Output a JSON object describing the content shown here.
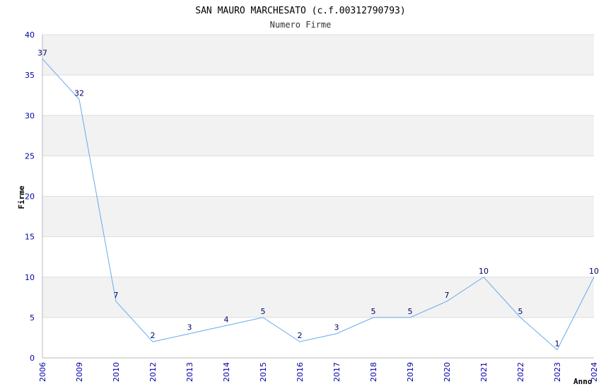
{
  "chart_data": {
    "type": "line",
    "title": "SAN MAURO MARCHESATO (c.f.00312790793)",
    "subtitle": "Numero Firme",
    "xlabel": "Anno",
    "ylabel": "Firme",
    "categories": [
      "2006",
      "2009",
      "2010",
      "2012",
      "2013",
      "2014",
      "2015",
      "2016",
      "2017",
      "2018",
      "2019",
      "2020",
      "2021",
      "2022",
      "2023",
      "2024"
    ],
    "values": [
      37,
      32,
      7,
      2,
      3,
      4,
      5,
      2,
      3,
      5,
      5,
      7,
      10,
      5,
      1,
      10
    ],
    "ylim": [
      0,
      40
    ],
    "yticks": [
      0,
      5,
      10,
      15,
      20,
      25,
      30,
      35,
      40
    ],
    "grid": true,
    "colors": {
      "line": "#66aaee",
      "band": "#f2f2f2",
      "grid": "#dddddd",
      "tick_text": "#0000aa",
      "label_text": "#000066"
    }
  }
}
